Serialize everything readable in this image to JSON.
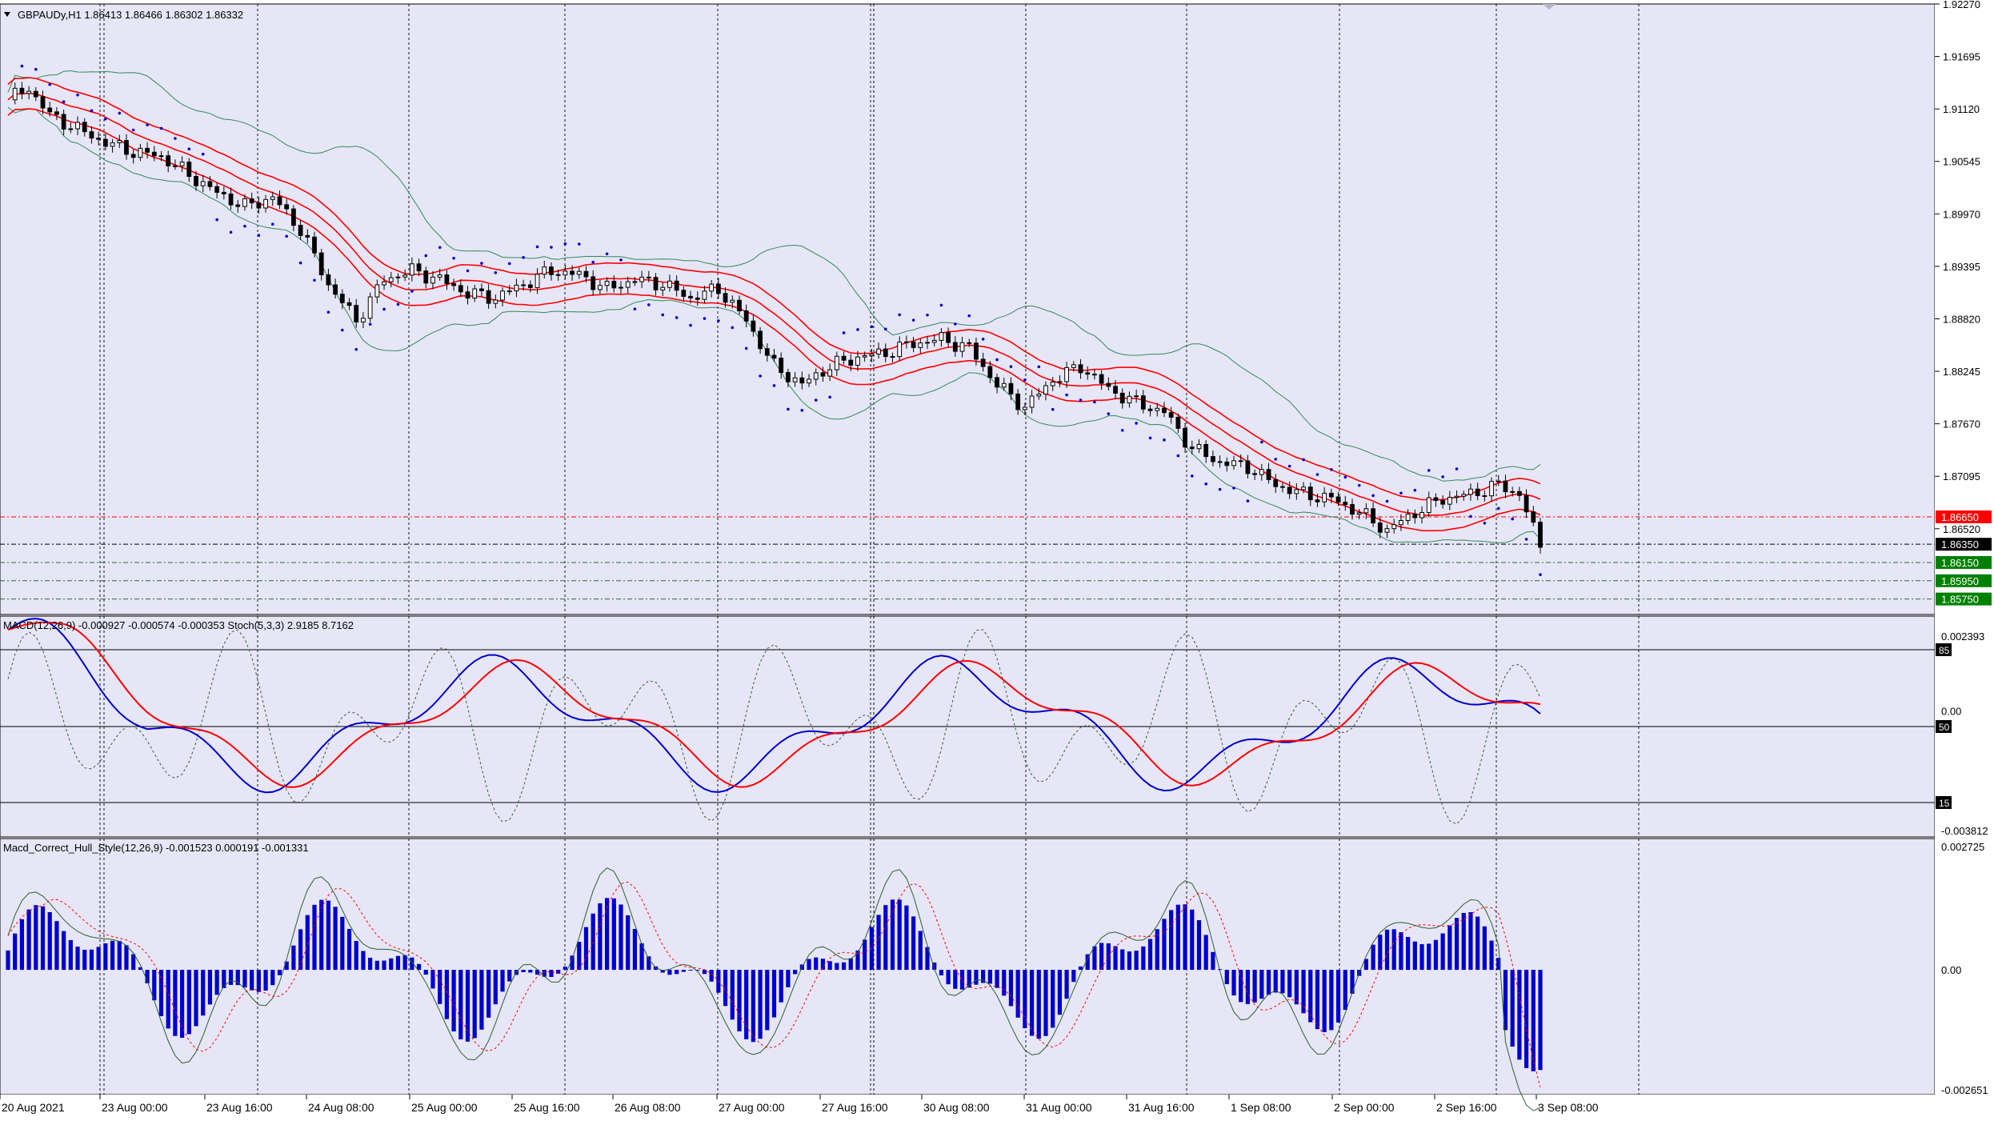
{
  "window": {
    "symbol_info": "GBPAUDy,H1  1.86413 1.86466 1.86302 1.86332"
  },
  "colors": {
    "background": "#e6e6f7",
    "grid": "#000000",
    "bull_candle": "#ffffff",
    "bear_candle": "#000000",
    "envelope": "#ff0000",
    "bollinger": "#2e8b57",
    "sar": "#0000cc",
    "macd_main": "#0000cc",
    "macd_signal": "#ff0000",
    "stoch": "#2e5e2e",
    "histogram": "#0000cc",
    "price_tag_red": "#ff0000",
    "price_tag_black": "#000000",
    "price_tag_green": "#008000"
  },
  "main_panel": {
    "price_ticks": [
      "1.92270",
      "1.91695",
      "1.91120",
      "1.90545",
      "1.89970",
      "1.89395",
      "1.88820",
      "1.88245",
      "1.87670",
      "1.87095",
      "1.86520"
    ],
    "price_tags": [
      {
        "label": "1.86650",
        "color": "red"
      },
      {
        "label": "1.86350",
        "color": "black"
      },
      {
        "label": "1.86150",
        "color": "green"
      },
      {
        "label": "1.85950",
        "color": "green"
      },
      {
        "label": "1.85750",
        "color": "green"
      }
    ]
  },
  "macd_panel": {
    "title": "MACD(12,26,9) -0.000927 -0.000574 -0.000353  Stoch(5,3,3) 2.9185 8.7162",
    "ticks": [
      "0.002393",
      "0.00",
      "-0.003812"
    ],
    "levels": [
      "85",
      "50",
      "15"
    ]
  },
  "hull_panel": {
    "title": "Macd_Correct_Hull_Style(12,26,9) -0.001523 0.000191 -0.001331",
    "ticks": [
      "0.002725",
      "0.00",
      "-0.002651"
    ]
  },
  "time_axis": {
    "labels": [
      "20 Aug 2021",
      "23 Aug 00:00",
      "23 Aug 16:00",
      "24 Aug 08:00",
      "25 Aug 00:00",
      "25 Aug 16:00",
      "26 Aug 08:00",
      "27 Aug 00:00",
      "27 Aug 16:00",
      "30 Aug 08:00",
      "31 Aug 00:00",
      "31 Aug 16:00",
      "1 Sep 08:00",
      "2 Sep 00:00",
      "2 Sep 16:00",
      "3 Sep 08:00"
    ]
  },
  "chart_data": {
    "type": "candlestick",
    "symbol": "GBPAUDy",
    "timeframe": "H1",
    "x_labels": [
      "20 Aug 2021",
      "23 Aug 00:00",
      "23 Aug 16:00",
      "24 Aug 08:00",
      "25 Aug 00:00",
      "25 Aug 16:00",
      "26 Aug 08:00",
      "27 Aug 00:00",
      "27 Aug 16:00",
      "30 Aug 08:00",
      "31 Aug 00:00",
      "31 Aug 16:00",
      "1 Sep 08:00",
      "2 Sep 00:00",
      "2 Sep 16:00",
      "3 Sep 08:00"
    ],
    "ylim": [
      1.8558,
      1.9227
    ],
    "close_path": [
      [
        0,
        1.9122
      ],
      [
        3,
        1.9135
      ],
      [
        6,
        1.9105
      ],
      [
        10,
        1.909
      ],
      [
        14,
        1.9075
      ],
      [
        18,
        1.9065
      ],
      [
        22,
        1.906
      ],
      [
        26,
        1.904
      ],
      [
        30,
        1.902
      ],
      [
        34,
        1.9005
      ],
      [
        38,
        1.9015
      ],
      [
        42,
        1.898
      ],
      [
        46,
        1.892
      ],
      [
        50,
        1.888
      ],
      [
        54,
        1.8925
      ],
      [
        58,
        1.8935
      ],
      [
        62,
        1.8925
      ],
      [
        66,
        1.891
      ],
      [
        70,
        1.8905
      ],
      [
        74,
        1.892
      ],
      [
        78,
        1.8935
      ],
      [
        82,
        1.893
      ],
      [
        86,
        1.8915
      ],
      [
        90,
        1.8925
      ],
      [
        94,
        1.892
      ],
      [
        98,
        1.8905
      ],
      [
        102,
        1.8915
      ],
      [
        106,
        1.888
      ],
      [
        110,
        1.883
      ],
      [
        114,
        1.881
      ],
      [
        118,
        1.883
      ],
      [
        122,
        1.884
      ],
      [
        126,
        1.8845
      ],
      [
        130,
        1.8855
      ],
      [
        134,
        1.886
      ],
      [
        138,
        1.885
      ],
      [
        142,
        1.881
      ],
      [
        146,
        1.8785
      ],
      [
        150,
        1.8815
      ],
      [
        154,
        1.883
      ],
      [
        158,
        1.8805
      ],
      [
        162,
        1.879
      ],
      [
        166,
        1.878
      ],
      [
        170,
        1.874
      ],
      [
        174,
        1.8725
      ],
      [
        178,
        1.872
      ],
      [
        182,
        1.87
      ],
      [
        186,
        1.869
      ],
      [
        190,
        1.8685
      ],
      [
        194,
        1.867
      ],
      [
        198,
        1.865
      ],
      [
        202,
        1.867
      ],
      [
        206,
        1.8685
      ],
      [
        210,
        1.869
      ],
      [
        214,
        1.87
      ],
      [
        217,
        1.869
      ],
      [
        220,
        1.8633
      ]
    ],
    "overlays": [
      "Envelopes (red)",
      "Bollinger Bands (green)",
      "Parabolic SAR (blue dots)"
    ],
    "horizontal_levels": [
      1.8665,
      1.8635,
      1.8615,
      1.8595,
      1.8575
    ]
  }
}
